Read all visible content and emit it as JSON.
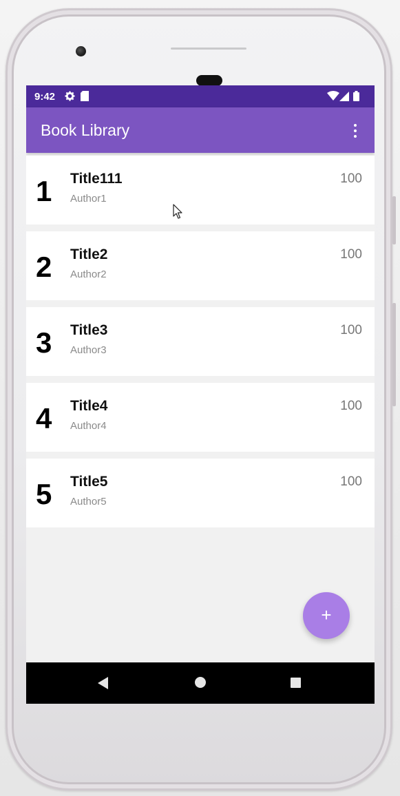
{
  "status_bar": {
    "time": "9:42",
    "icons_left": [
      "gear-icon",
      "sd-card-icon"
    ],
    "icons_right": [
      "wifi-icon",
      "signal-icon",
      "battery-icon"
    ]
  },
  "app_bar": {
    "title": "Book Library",
    "menu_icon": "more-vert-icon",
    "color": "#7c55c1",
    "status_color": "#4b2a9a"
  },
  "books": [
    {
      "id": "1",
      "title": "Title111",
      "author": "Author1",
      "pages": "100"
    },
    {
      "id": "2",
      "title": "Title2",
      "author": "Author2",
      "pages": "100"
    },
    {
      "id": "3",
      "title": "Title3",
      "author": "Author3",
      "pages": "100"
    },
    {
      "id": "4",
      "title": "Title4",
      "author": "Author4",
      "pages": "100"
    },
    {
      "id": "5",
      "title": "Title5",
      "author": "Author5",
      "pages": "100"
    }
  ],
  "fab": {
    "label": "+",
    "icon": "add-icon",
    "color": "#a97ee6"
  },
  "nav_bar": {
    "icons": [
      "back-icon",
      "home-icon",
      "recents-icon"
    ]
  }
}
